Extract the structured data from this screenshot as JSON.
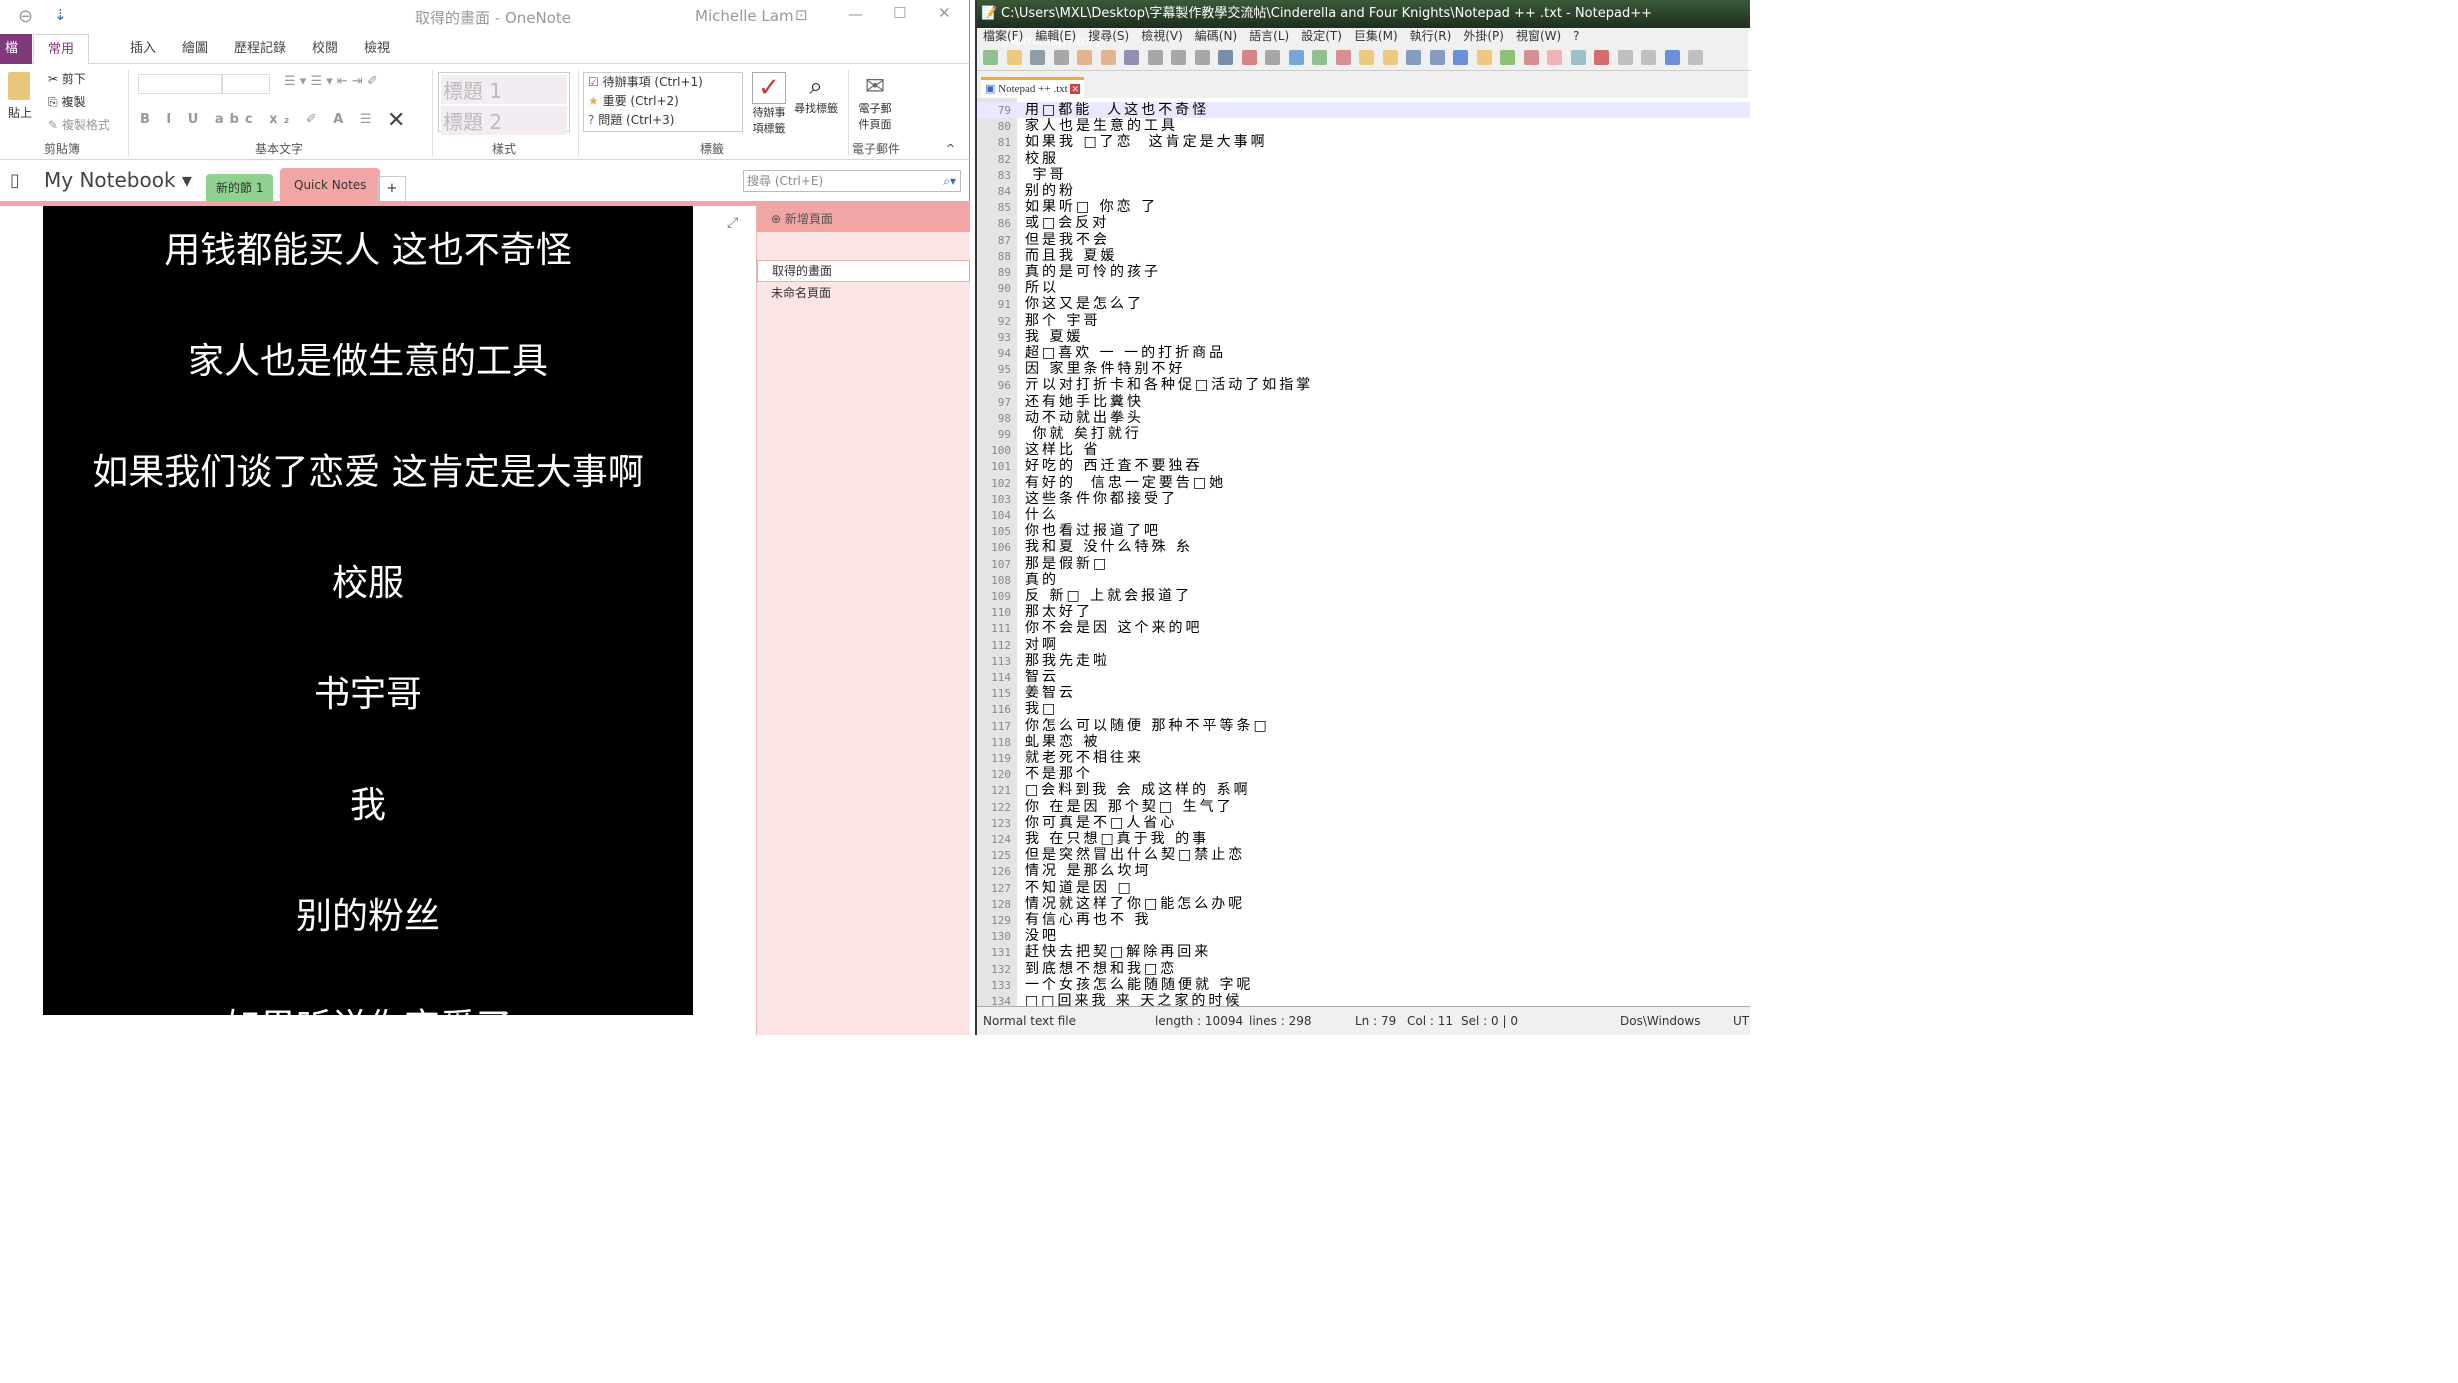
{
  "onenote": {
    "title": "取得的畫面 - OneNote",
    "user": "Michelle Lam",
    "tabs": [
      "檔案",
      "常用",
      "插入",
      "繪圖",
      "歷程記錄",
      "校閱",
      "檢視"
    ],
    "clipboard": {
      "paste": "貼上",
      "cut": "剪下",
      "copy": "複製",
      "format_painter": "複製格式",
      "label": "剪貼簿"
    },
    "basic_text_label": "基本文字",
    "styles": {
      "items": [
        "標題 1",
        "標題 2"
      ],
      "label": "樣式"
    },
    "tags": {
      "items": [
        "待辦事項 (Ctrl+1)",
        "重要 (Ctrl+2)",
        "問題 (Ctrl+3)"
      ],
      "todo_tag": "待辦事項標籤",
      "find_tags": "尋找標籤",
      "label": "標籤"
    },
    "email": {
      "button": "電子郵件頁面",
      "label": "電子郵件"
    },
    "notebook": "My Notebook",
    "sections": [
      "新的節 1",
      "Quick Notes"
    ],
    "search_placeholder": "搜尋 (Ctrl+E)",
    "add_page": "新增頁面",
    "pages": [
      "取得的畫面",
      "未命名頁面"
    ],
    "video_lines": [
      "用钱都能买人 这也不奇怪",
      "家人也是做生意的工具",
      "如果我们谈了恋爱 这肯定是大事啊",
      "校服",
      "书宇哥",
      "我",
      "别的粉丝",
      "如果听说你恋爱了"
    ],
    "colors": {
      "file_tab": "#80397b",
      "section1": "#8fd18f",
      "quicknotes": "#f2a5a5"
    }
  },
  "notepad": {
    "title": "C:\\Users\\MXL\\Desktop\\字幕製作教學交流帖\\Cinderella and Four Knights\\Notepad ++ .txt - Notepad++ [Administrator]",
    "menu": [
      "檔案(F)",
      "編輯(E)",
      "搜尋(S)",
      "檢視(V)",
      "編碼(N)",
      "語言(L)",
      "設定(T)",
      "巨集(M)",
      "執行(R)",
      "外掛(P)",
      "視窗(W)",
      "?"
    ],
    "tab": "Notepad ++ .txt",
    "first_line": 79,
    "lines": [
      "用□都能  人这也不奇怪",
      "家人也是生意的工具",
      "如果我 □了恋  这肯定是大事啊",
      "校服",
      " 宇哥",
      "别的粉",
      "如果听□ 你恋 了",
      "或□会反对",
      "但是我不会",
      "而且我 夏媛",
      "真的是可怜的孩子",
      "所以",
      "你这又是怎么了",
      "那个 宇哥",
      "我 夏媛",
      "超□喜欢 一 一的打折商品",
      "因 家里条件特别不好",
      "亓以对打折卡和各种促□活动了如指掌",
      "还有她手比糞快",
      "动不动就出拳头",
      " 你就 矣打就行",
      "这样比 省",
      "好吃的 西迁査不要独吞",
      "有好的  信忠一定要告□她",
      "这些条件你都接受了",
      "什么",
      "你也看过报道了吧",
      "我和夏 没什么特殊 糸",
      "那是假新□",
      "真的",
      "反 新□ 上就会报道了",
      "那太好了",
      "你不会是因 这个来的吧",
      "对啊",
      "那我先走啦",
      "智云",
      "姜智云",
      "我□",
      "你怎么可以随便 那种不平等条□",
      "虬果恋 被",
      "就老死不相往来",
      "不是那个",
      "□会料到我 会 成这样的 系啊",
      "你 在是因 那个契□ 生气了",
      "你可真是不□人省心",
      "我 在只想□真于我 的事",
      "但是突然冒出什么契□禁止恋",
      "情况 是那么坎坷",
      "不知道是因 □",
      "情况就这样了你□能怎么办呢",
      "有信心再也不 我",
      "没吧",
      "赶快去把契□解除再回来",
      "到底想不想和我□恋",
      "一个女孩怎么能随随便就 字呢",
      "□□回来我 来 天之家的时候"
    ],
    "status": {
      "type": "Normal text file",
      "length": "length : 10094",
      "lines": "lines : 298",
      "pos": "Ln : 79",
      "col": "Col : 11",
      "sel": "Sel : 0 | 0",
      "eol": "Dos\\Windows",
      "enc": "UT"
    }
  }
}
